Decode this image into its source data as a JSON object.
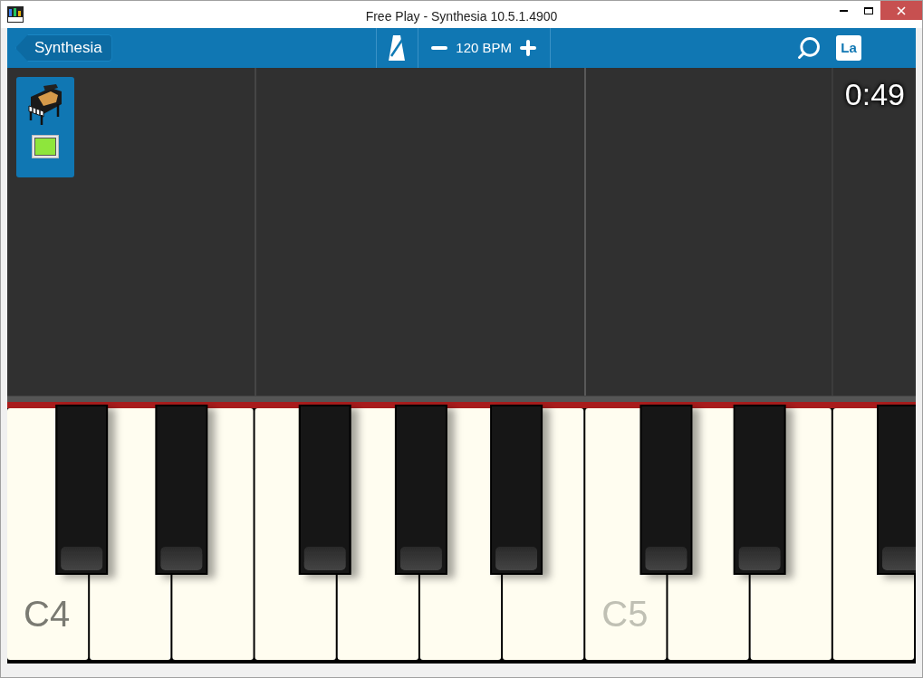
{
  "window": {
    "title": "Free Play - Synthesia 10.5.1.4900"
  },
  "toolbar": {
    "back_button": "Synthesia",
    "tempo": "120 BPM",
    "language_button": "La"
  },
  "tracks": [
    {
      "kind": "piano",
      "color": "#8ee63c"
    }
  ],
  "timer": "0:49",
  "keyboard": {
    "octave_labels": [
      {
        "text": "C4",
        "dim": false
      },
      {
        "text": "C5",
        "dim": true
      }
    ]
  }
}
